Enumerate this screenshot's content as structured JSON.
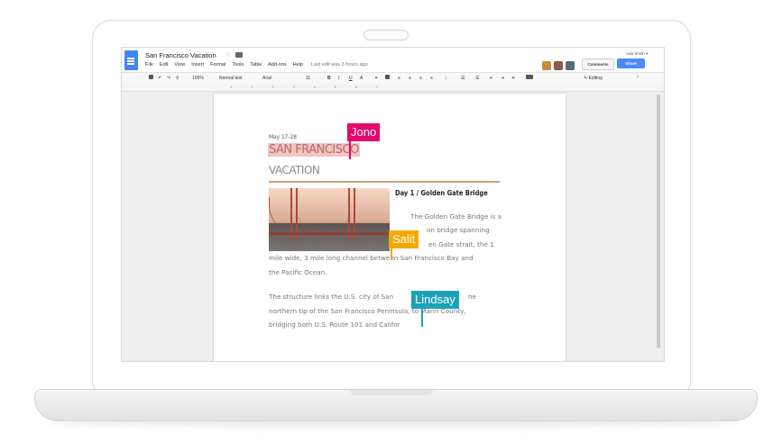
{
  "header": {
    "doc_title": "San Francisco Vacation",
    "menu": [
      "File",
      "Edit",
      "View",
      "Insert",
      "Format",
      "Tools",
      "Table",
      "Add-ons",
      "Help"
    ],
    "last_edit": "Last edit was 3 hours ago",
    "user_name": "Ada Smith ▾",
    "comments_label": "Comments",
    "share_label": "Share"
  },
  "toolbar": {
    "zoom": "100%",
    "style": "Normal text",
    "font": "Arial",
    "size": "11",
    "bold": "B",
    "italic": "I",
    "underline": "U",
    "text_color": "A",
    "mode": "Editing"
  },
  "ruler": {
    "marks": "1 · · · · 1 · · · · 2 · · · · 3 · · · · 4 · · · · 5 · · · · 6 · · · · 7"
  },
  "document": {
    "date": "May 17-28",
    "title": "SAN FRANCISCO",
    "subtitle": "VACATION",
    "day_heading": "Day 1 / Golden Gate Bridge",
    "para1_lines": [
      "The Golden Gate Bridge is a",
      "on bridge spanning",
      "en Gate strait, the 1",
      "mile wide, 3 mile long channel between San Francisco Bay and",
      "the Pacific Ocean."
    ],
    "para2_lines": [
      "The structure links the U.S. city of San",
      "he",
      "northern tip of the San Francisco Peninsula, to Marin County,",
      "bridging both U.S. Route 101 and Califor"
    ]
  },
  "collaborators": [
    {
      "name": "Jono",
      "color": "#e6086a"
    },
    {
      "name": "Salit",
      "color": "#f5a800"
    },
    {
      "name": "Lindsay",
      "color": "#1aa3b8"
    }
  ],
  "colors": {
    "accent_blue": "#4285f4",
    "title_highlight": "#f2c4c4",
    "divider": "#c9a27e"
  }
}
